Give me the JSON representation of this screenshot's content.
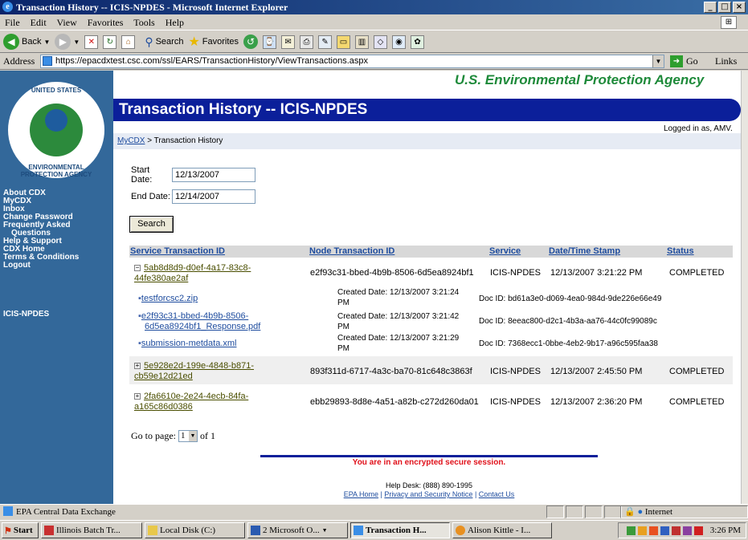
{
  "window": {
    "title": "Transaction History -- ICIS-NPDES - Microsoft Internet Explorer"
  },
  "menu": {
    "items": [
      "File",
      "Edit",
      "View",
      "Favorites",
      "Tools",
      "Help"
    ]
  },
  "toolbar": {
    "back": "Back",
    "search": "Search",
    "favorites": "Favorites"
  },
  "address": {
    "label": "Address",
    "url": "https://epacdxtest.csc.com/ssl/EARS/TransactionHistory/ViewTransactions.aspx",
    "go": "Go",
    "links": "Links"
  },
  "sidebar": {
    "seal_top": "UNITED STATES",
    "seal_bottom": "ENVIRONMENTAL PROTECTION AGENCY",
    "nav": [
      "About CDX",
      "MyCDX",
      "Inbox",
      "Change Password",
      "Frequently Asked",
      "Questions",
      "Help & Support",
      "CDX Home",
      "Terms & Conditions",
      "Logout"
    ],
    "program": "ICIS-NPDES"
  },
  "header": {
    "agency": "U.S. Environmental Protection Agency",
    "title": "Transaction History -- ICIS-NPDES",
    "logged_in": "Logged in as, AMV.",
    "breadcrumb_link": "MyCDX",
    "breadcrumb_rest": " > Transaction History"
  },
  "form": {
    "start_label": "Start Date:",
    "start_value": "12/13/2007",
    "end_label": "End Date:",
    "end_value": "12/14/2007",
    "search_button": "Search"
  },
  "table": {
    "columns": [
      "Service Transaction ID",
      "Node Transaction ID",
      "Service",
      "Date/Time Stamp",
      "Status"
    ],
    "rows": [
      {
        "toggle": "−",
        "id_line1": "5ab8d8d9-d0ef-4a17-83c8-",
        "id_line2": "44fe380ae2af",
        "node": "e2f93c31-bbed-4b9b-8506-6d5ea8924bf1",
        "service": "ICIS-NPDES",
        "date": "12/13/2007 3:21:22 PM",
        "status": "COMPLETED",
        "documents": [
          {
            "name": "testforcsc2.zip",
            "name2": "",
            "created": "Created Date: 12/13/2007 3:21:24",
            "created2": "PM",
            "doc": "Doc ID: bd61a3e0-d069-4ea0-984d-9de226e66e49"
          },
          {
            "name": "e2f93c31-bbed-4b9b-8506-",
            "name2": "6d5ea8924bf1_Response.pdf",
            "created": "Created Date: 12/13/2007 3:21:42",
            "created2": "PM",
            "doc": "Doc ID: 8eeac800-d2c1-4b3a-aa76-44c0fc99089c"
          },
          {
            "name": "submission-metdata.xml",
            "name2": "",
            "created": "Created Date: 12/13/2007 3:21:29",
            "created2": "PM",
            "doc": "Doc ID: 7368ecc1-0bbe-4eb2-9b17-a96c595faa38"
          }
        ]
      },
      {
        "toggle": "+",
        "id_line1": "5e928e2d-199e-4848-b871-",
        "id_line2": "cb59e12d21ed",
        "node": "893f311d-6717-4a3c-ba70-81c648c3863f",
        "service": "ICIS-NPDES",
        "date": "12/13/2007 2:45:50 PM",
        "status": "COMPLETED"
      },
      {
        "toggle": "+",
        "id_line1": "2fa6610e-2e24-4ecb-84fa-",
        "id_line2": "a165c86d0386",
        "node": "ebb29893-8d8e-4a51-a82b-c272d260da01",
        "service": "ICIS-NPDES",
        "date": "12/13/2007 2:36:20 PM",
        "status": "COMPLETED"
      }
    ]
  },
  "pagination": {
    "label": "Go to page:",
    "value": "1",
    "of": "of 1"
  },
  "footer": {
    "secure": "You are in an encrypted secure session.",
    "helpdesk": "Help Desk: (888) 890-1995",
    "links": [
      "EPA Home",
      "Privacy and Security Notice",
      "Contact Us"
    ]
  },
  "status": {
    "text": "EPA Central Data Exchange",
    "zone": "Internet"
  },
  "taskbar": {
    "start": "Start",
    "buttons": [
      "Illinois Batch Tr...",
      "Local Disk (C:)",
      "2 Microsoft O...",
      "Transaction H...",
      "Alison Kittle - I..."
    ],
    "clock": "3:26 PM"
  }
}
